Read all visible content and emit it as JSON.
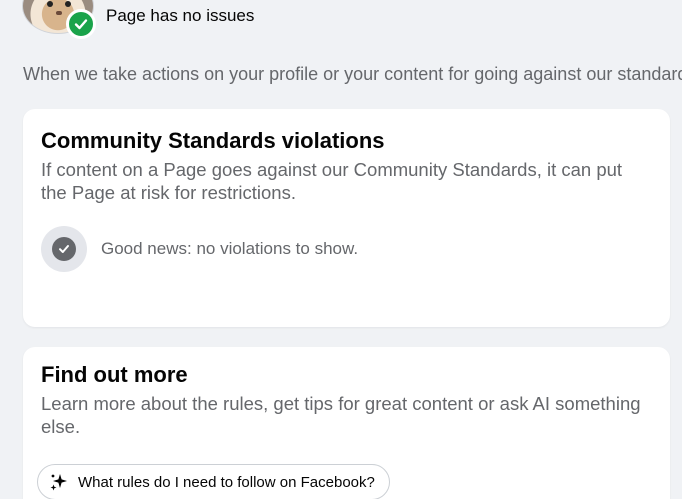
{
  "top": {
    "status_text": "Page has no issues",
    "badge_color": "#1aa34a"
  },
  "notice": "When we take actions on your profile or your content for going against our standards",
  "violations_card": {
    "title": "Community Standards violations",
    "description": "If content on a Page goes against our Community Standards, it can put the Page at risk for restrictions.",
    "status_text": "Good news: no violations to show."
  },
  "find_out_card": {
    "title": "Find out more",
    "description": "Learn more about the rules, get tips for great content or ask AI something else.",
    "prompt_label": "What rules do I need to follow on Facebook?",
    "prompt_icon": "ai-sparkle-icon"
  }
}
